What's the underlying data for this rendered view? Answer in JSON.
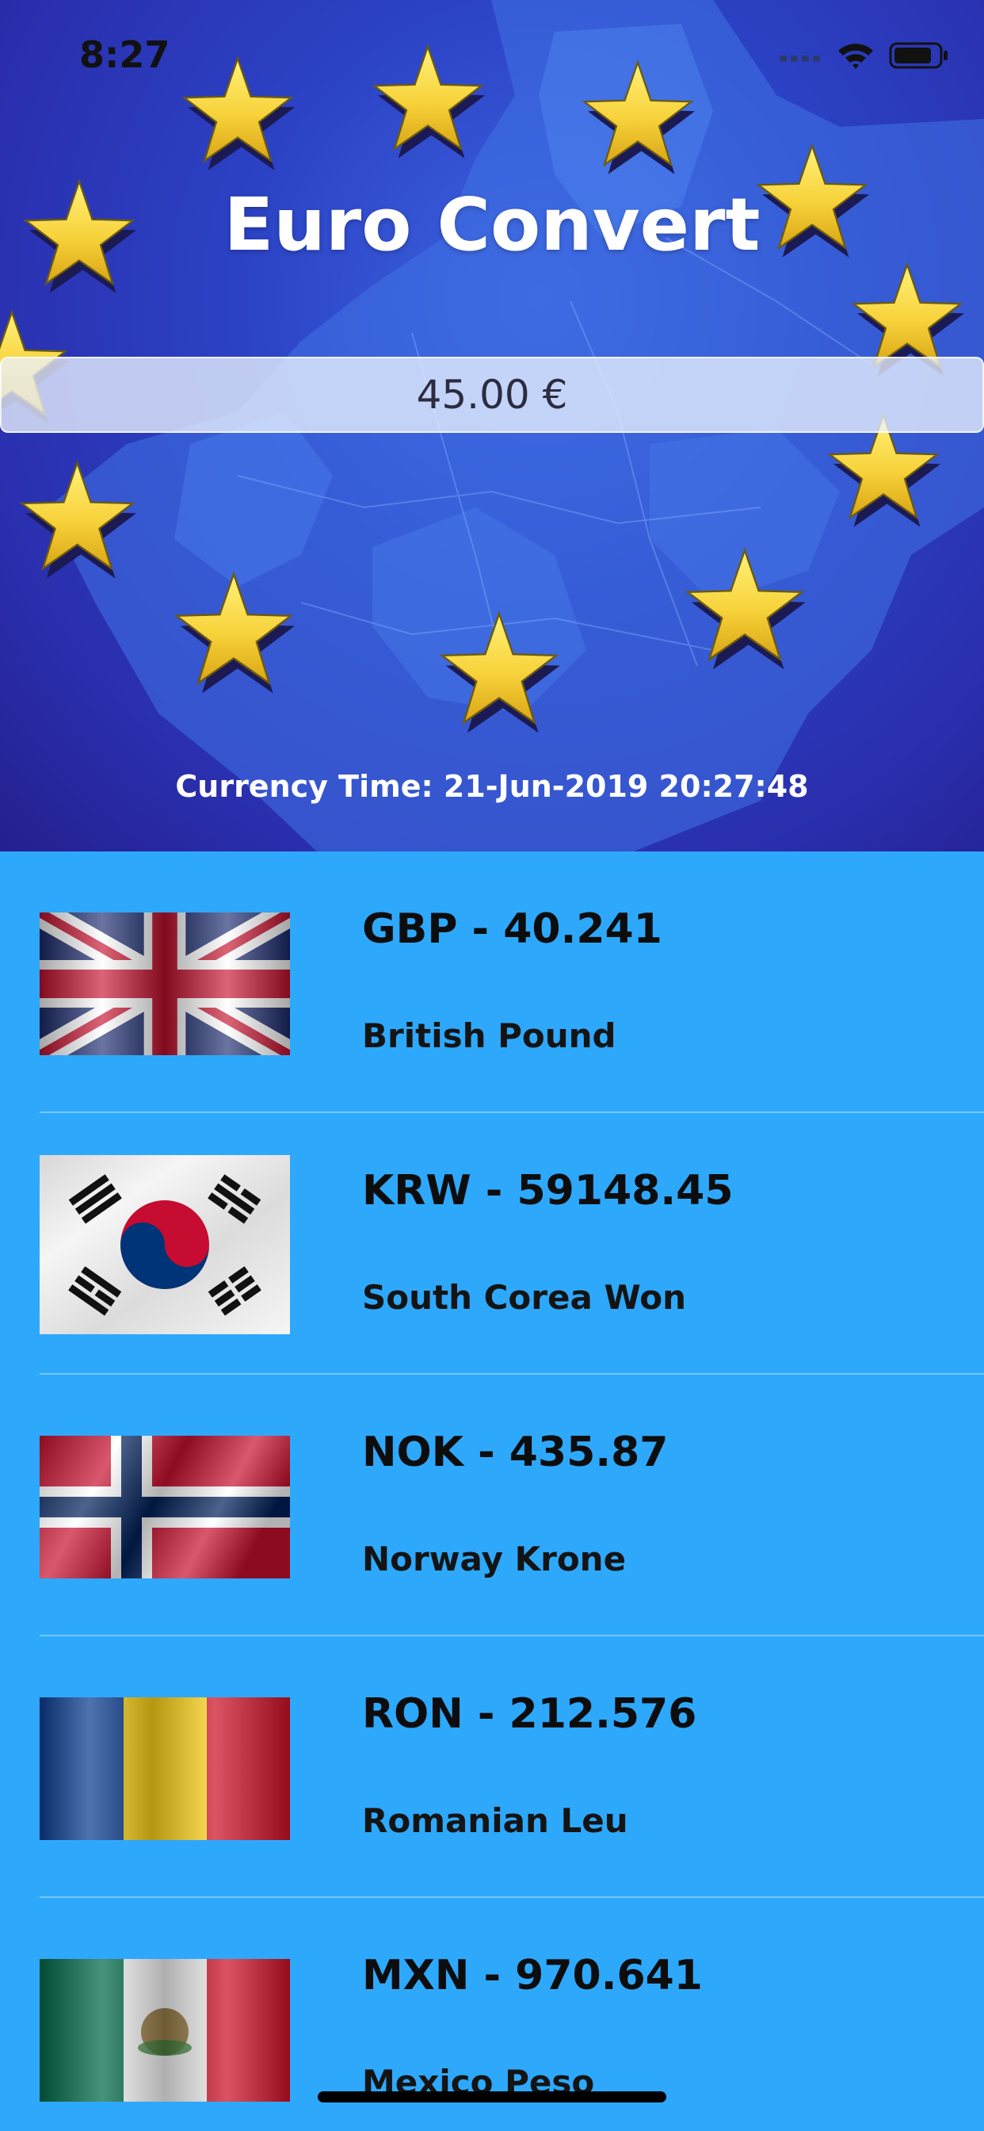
{
  "status_bar": {
    "time": "8:27",
    "wifi_icon": "wifi-icon",
    "battery_icon": "battery-icon"
  },
  "header": {
    "title": "Euro Convert",
    "amount_value": "45.00 €",
    "currency_time": "Currency Time: 21-Jun-2019 20:27:48"
  },
  "currencies": [
    {
      "code_rate": "GBP - 40.241",
      "name": "British Pound",
      "flag": "uk-flag"
    },
    {
      "code_rate": "KRW - 59148.45",
      "name": "South Corea Won",
      "flag": "south-korea-flag"
    },
    {
      "code_rate": "NOK - 435.87",
      "name": "Norway Krone",
      "flag": "norway-flag"
    },
    {
      "code_rate": "RON - 212.576",
      "name": "Romanian Leu",
      "flag": "romania-flag"
    },
    {
      "code_rate": "MXN - 970.641",
      "name": "Mexico Peso",
      "flag": "mexico-flag"
    }
  ],
  "colors": {
    "list_background": "#2ea8fb",
    "header_blue": "#2b42c4",
    "star_yellow": "#f7d23a"
  }
}
